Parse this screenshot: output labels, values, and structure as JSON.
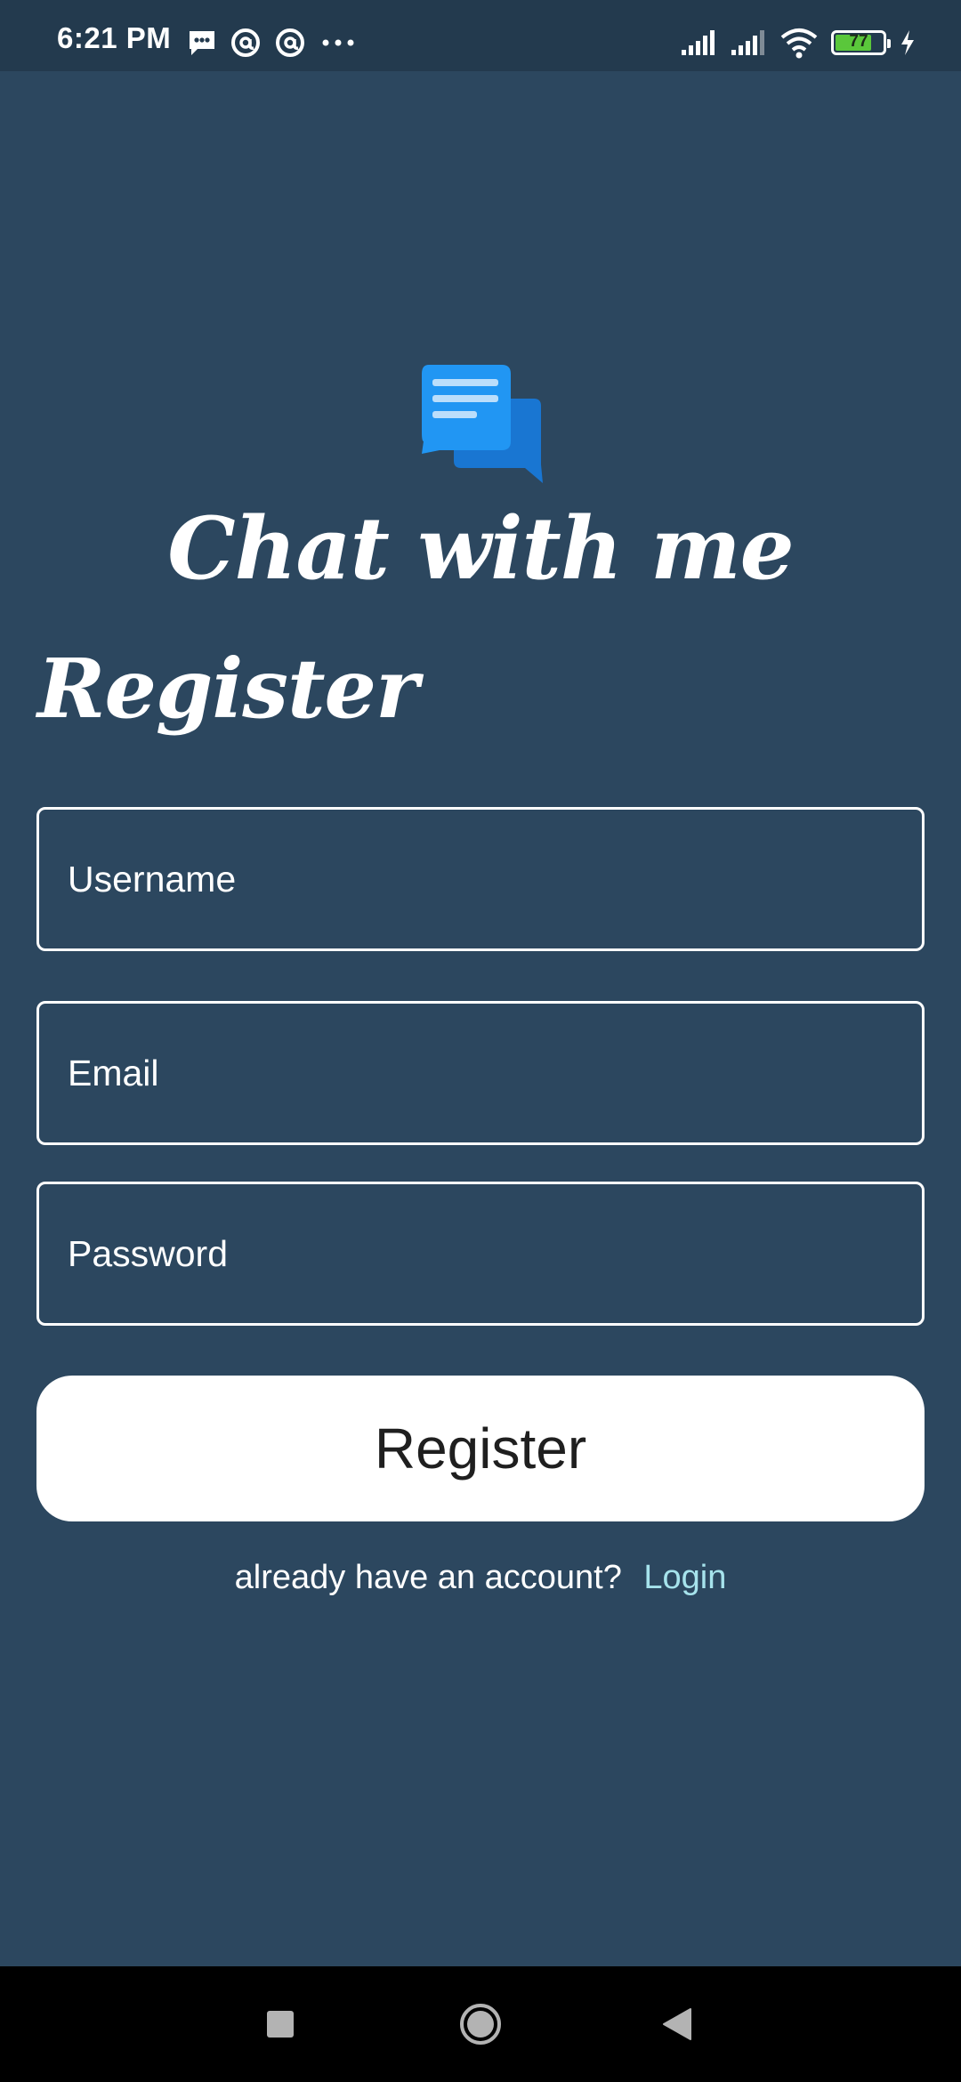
{
  "status_bar": {
    "time": "6:21 PM",
    "left_icons": [
      "message-icon",
      "at-icon",
      "at-icon",
      "more-icon"
    ],
    "right_icons": [
      "signal-icon",
      "signal-icon",
      "wifi-icon",
      "battery-icon",
      "charging-icon"
    ],
    "battery_level": "77",
    "battery_fraction": 0.77
  },
  "app": {
    "logo_icon": "chat-bubbles-icon",
    "title": "Chat with me"
  },
  "form": {
    "heading": "Register",
    "username_placeholder": "Username",
    "email_placeholder": "Email",
    "password_placeholder": "Password",
    "username_value": "",
    "email_value": "",
    "password_value": "",
    "submit_label": "Register"
  },
  "footer": {
    "prompt": "already have an account?",
    "login_label": "Login"
  },
  "navigation": {
    "buttons": [
      "recents-icon",
      "home-icon",
      "back-icon"
    ]
  },
  "colors": {
    "background": "#2c475f",
    "status_bar": "#233a4e",
    "accent_link": "#a6e3ec",
    "logo_light": "#2196f3",
    "logo_dark": "#1976d2",
    "battery": "#5ac73b"
  }
}
